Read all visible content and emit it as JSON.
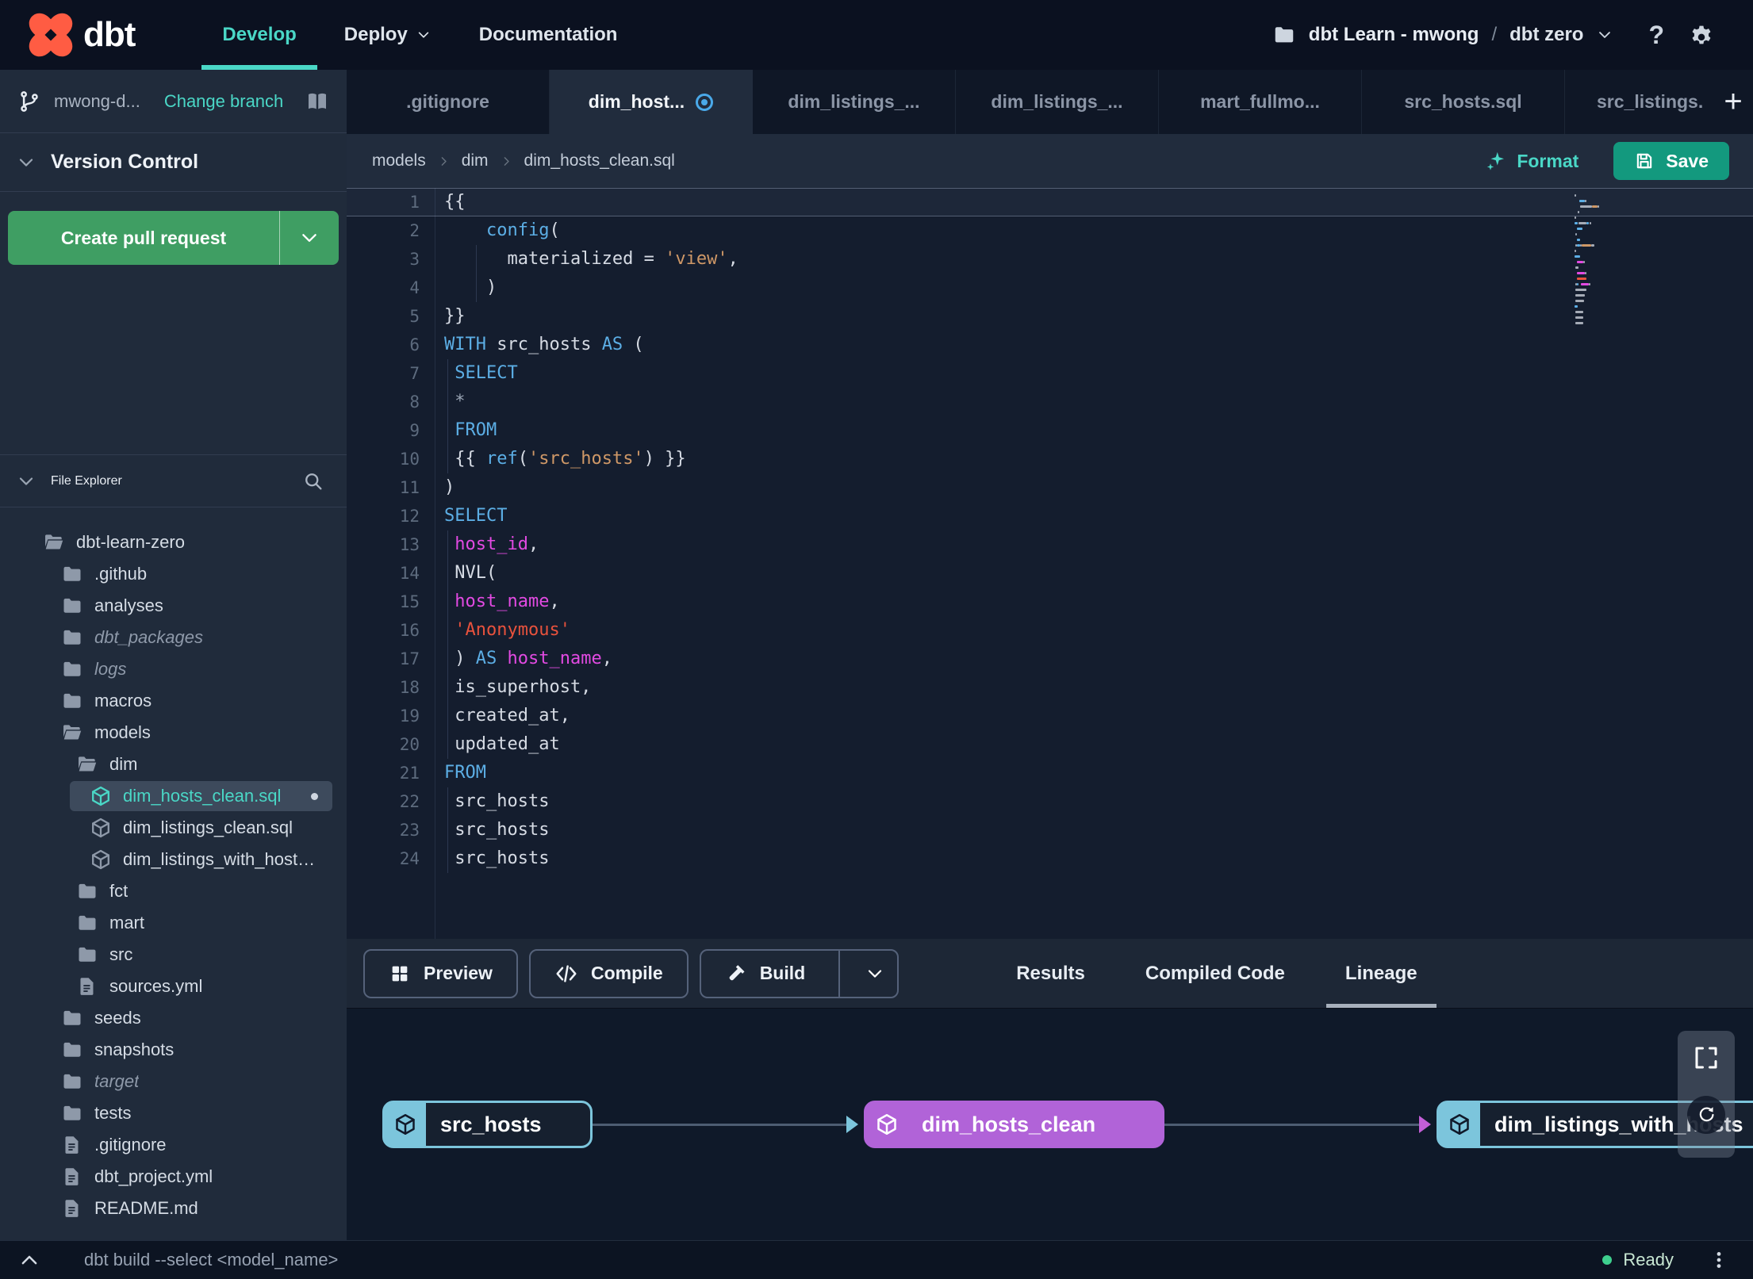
{
  "topbar": {
    "brand": "dbt",
    "nav": [
      {
        "label": "Develop",
        "active": true,
        "dropdown": false
      },
      {
        "label": "Deploy",
        "active": false,
        "dropdown": true
      },
      {
        "label": "Documentation",
        "active": false,
        "dropdown": false
      }
    ],
    "project_breadcrumb": {
      "icon": "folder-icon",
      "account": "dbt Learn - mwong",
      "separator": "/",
      "project": "dbt zero",
      "dropdown_icon": "chevron-down-icon"
    },
    "help_label": "?",
    "settings_icon": "gear-icon"
  },
  "sidebar": {
    "branch": {
      "icon": "git-branch-icon",
      "name": "mwong-d...",
      "change_link": "Change branch",
      "docs_icon": "book-icon"
    },
    "version_control": {
      "title": "Version Control",
      "create_pr_label": "Create pull request"
    },
    "file_explorer": {
      "title": "File Explorer",
      "search_icon": "search-icon",
      "tree": [
        {
          "label": "dbt-learn-zero",
          "icon": "folder-open",
          "level": 0
        },
        {
          "label": ".github",
          "icon": "folder",
          "level": 1
        },
        {
          "label": "analyses",
          "icon": "folder",
          "level": 1
        },
        {
          "label": "dbt_packages",
          "icon": "folder",
          "level": 1,
          "italic": true
        },
        {
          "label": "logs",
          "icon": "folder",
          "level": 1,
          "italic": true
        },
        {
          "label": "macros",
          "icon": "folder",
          "level": 1
        },
        {
          "label": "models",
          "icon": "folder-open",
          "level": 1
        },
        {
          "label": "dim",
          "icon": "folder-open",
          "level": 2
        },
        {
          "label": "dim_hosts_clean.sql",
          "icon": "model",
          "level": 3,
          "selected": true,
          "modified": true
        },
        {
          "label": "dim_listings_clean.sql",
          "icon": "model",
          "level": 3
        },
        {
          "label": "dim_listings_with_hosts...",
          "icon": "model",
          "level": 3
        },
        {
          "label": "fct",
          "icon": "folder",
          "level": 2
        },
        {
          "label": "mart",
          "icon": "folder",
          "level": 2
        },
        {
          "label": "src",
          "icon": "folder",
          "level": 2
        },
        {
          "label": "sources.yml",
          "icon": "file",
          "level": 2
        },
        {
          "label": "seeds",
          "icon": "folder",
          "level": 1
        },
        {
          "label": "snapshots",
          "icon": "folder",
          "level": 1
        },
        {
          "label": "target",
          "icon": "folder",
          "level": 1,
          "italic": true
        },
        {
          "label": "tests",
          "icon": "folder",
          "level": 1
        },
        {
          "label": ".gitignore",
          "icon": "file",
          "level": 1
        },
        {
          "label": "dbt_project.yml",
          "icon": "file",
          "level": 1
        },
        {
          "label": "README.md",
          "icon": "file",
          "level": 1
        }
      ]
    }
  },
  "editor_tabs": {
    "tabs": [
      {
        "label": ".gitignore",
        "active": false,
        "dirty": false
      },
      {
        "label": "dim_host...",
        "active": true,
        "dirty": true
      },
      {
        "label": "dim_listings_...",
        "active": false,
        "dirty": false
      },
      {
        "label": "dim_listings_...",
        "active": false,
        "dirty": false
      },
      {
        "label": "mart_fullmo...",
        "active": false,
        "dirty": false
      },
      {
        "label": "src_hosts.sql",
        "active": false,
        "dirty": false
      },
      {
        "label": "src_listings.",
        "active": false,
        "dirty": false
      }
    ],
    "new_tab_label": "+"
  },
  "file_header": {
    "breadcrumb": [
      "models",
      "dim",
      "dim_hosts_clean.sql"
    ],
    "format_label": "Format",
    "format_icon": "sparkle-icon",
    "save_label": "Save",
    "save_icon": "save-icon"
  },
  "editor": {
    "lines": [
      {
        "n": 1,
        "current": true,
        "tokens": [
          [
            "{{",
            "p"
          ]
        ]
      },
      {
        "n": 2,
        "tokens": [
          [
            "    ",
            "p"
          ],
          [
            "config",
            "kw"
          ],
          [
            "(",
            "p"
          ]
        ]
      },
      {
        "n": 3,
        "guide": 1,
        "tokens": [
          [
            "      materialized = ",
            "p"
          ],
          [
            "'view'",
            "str"
          ],
          [
            ",",
            "p"
          ]
        ]
      },
      {
        "n": 4,
        "guide": 1,
        "tokens": [
          [
            "    )",
            "p"
          ]
        ]
      },
      {
        "n": 5,
        "tokens": [
          [
            "}}",
            "p"
          ]
        ]
      },
      {
        "n": 6,
        "tokens": [
          [
            "WITH",
            "kw"
          ],
          [
            " src_hosts ",
            "p"
          ],
          [
            "AS",
            "kw"
          ],
          [
            " (",
            "p"
          ]
        ]
      },
      {
        "n": 7,
        "guide": 0,
        "tokens": [
          [
            " ",
            "p"
          ],
          [
            "SELECT",
            "kw"
          ]
        ]
      },
      {
        "n": 8,
        "guide": 0,
        "tokens": [
          [
            " *",
            "dim"
          ]
        ]
      },
      {
        "n": 9,
        "guide": 0,
        "tokens": [
          [
            " ",
            "p"
          ],
          [
            "FROM",
            "kw"
          ]
        ]
      },
      {
        "n": 10,
        "guide": 0,
        "tokens": [
          [
            " {{ ",
            "p"
          ],
          [
            "ref",
            "kw"
          ],
          [
            "(",
            "p"
          ],
          [
            "'src_hosts'",
            "str"
          ],
          [
            ") }}",
            "p"
          ]
        ]
      },
      {
        "n": 11,
        "tokens": [
          [
            ")",
            "p"
          ]
        ]
      },
      {
        "n": 12,
        "tokens": [
          [
            "SELECT",
            "kw"
          ]
        ]
      },
      {
        "n": 13,
        "guide": 0,
        "tokens": [
          [
            " ",
            "p"
          ],
          [
            "host_id",
            "col"
          ],
          [
            ",",
            "p"
          ]
        ]
      },
      {
        "n": 14,
        "guide": 0,
        "tokens": [
          [
            " NVL(",
            "p"
          ]
        ]
      },
      {
        "n": 15,
        "guide": 0,
        "tokens": [
          [
            " ",
            "p"
          ],
          [
            "host_name",
            "col"
          ],
          [
            ",",
            "p"
          ]
        ]
      },
      {
        "n": 16,
        "guide": 0,
        "tokens": [
          [
            " ",
            "p"
          ],
          [
            "'Anonymous'",
            "red"
          ]
        ]
      },
      {
        "n": 17,
        "guide": 0,
        "tokens": [
          [
            " ) ",
            "p"
          ],
          [
            "AS",
            "kw"
          ],
          [
            " ",
            "p"
          ],
          [
            "host_name",
            "col"
          ],
          [
            ",",
            "p"
          ]
        ]
      },
      {
        "n": 18,
        "guide": 0,
        "tokens": [
          [
            " is_superhost,",
            "p"
          ]
        ]
      },
      {
        "n": 19,
        "guide": 0,
        "tokens": [
          [
            " created_at,",
            "p"
          ]
        ]
      },
      {
        "n": 20,
        "guide": 0,
        "tokens": [
          [
            " updated_at",
            "p"
          ]
        ]
      },
      {
        "n": 21,
        "tokens": [
          [
            "FROM",
            "kw"
          ]
        ]
      },
      {
        "n": 22,
        "guide": 0,
        "tokens": [
          [
            " src_hosts",
            "p"
          ]
        ]
      },
      {
        "n": 23,
        "guide": 0,
        "tokens": [
          [
            " src_hosts",
            "p"
          ]
        ]
      },
      {
        "n": 24,
        "guide": 0,
        "tokens": [
          [
            " src_hosts",
            "p"
          ]
        ]
      }
    ]
  },
  "action_bar": {
    "preview": {
      "label": "Preview",
      "icon": "grid-icon"
    },
    "compile": {
      "label": "Compile",
      "icon": "code-icon"
    },
    "build": {
      "label": "Build",
      "icon": "hammer-icon",
      "dropdown_icon": "chevron-down-icon"
    }
  },
  "result_tabs": [
    {
      "label": "Results",
      "active": false
    },
    {
      "label": "Compiled Code",
      "active": false
    },
    {
      "label": "Lineage",
      "active": true
    }
  ],
  "lineage": {
    "nodes": [
      {
        "label": "src_hosts",
        "style": "blue",
        "icon": "model-cube-icon"
      },
      {
        "label": "dim_hosts_clean",
        "style": "purple",
        "icon": "model-cube-icon"
      },
      {
        "label": "dim_listings_with_hosts",
        "style": "blue",
        "icon": "model-cube-icon"
      }
    ],
    "controls": {
      "fullscreen_icon": "fullscreen-icon",
      "refresh_icon": "refresh-icon"
    }
  },
  "statusbar": {
    "command": "dbt build --select <model_name>",
    "status": "Ready"
  },
  "colors": {
    "accent_teal": "#4ad7c6",
    "green_button": "#3f9e63",
    "save_button": "#13997e",
    "node_blue": "#7cc5dc",
    "node_purple": "#b163d8",
    "edge_arrow_blue": "#7cc5dc",
    "edge_arrow_purple": "#c45fd8",
    "syntax_keyword": "#5caee5",
    "syntax_string": "#cf9867",
    "syntax_string_red": "#e8523d",
    "syntax_column": "#e24ae2",
    "status_green": "#3ecf8e",
    "tab_dirty_blue": "#4aa9e9",
    "logo_orange": "#ff5c43"
  }
}
